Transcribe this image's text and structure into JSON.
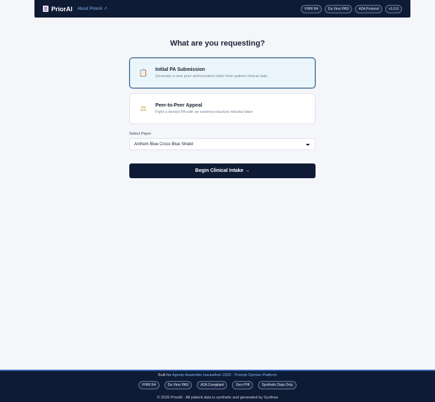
{
  "header": {
    "logo_icon": "clipboard-icon",
    "logo_text": "PriorAI",
    "about_link": "About PriorAI ↗",
    "badges": [
      "FHIR R4",
      "Da Vinci PAS",
      "A2A Protocol",
      "v1.0.0"
    ]
  },
  "main": {
    "title": "What are you requesting?",
    "options": [
      {
        "icon": "clipboard-icon",
        "glyph": "📋",
        "title": "Initial PA Submission",
        "description": "Generate a new prior authorization letter from patient clinical data"
      },
      {
        "icon": "scales-icon",
        "glyph": "⚖",
        "title": "Peer-to-Peer Appeal",
        "description": "Fight a denied PA with an evidence-backed rebuttal letter"
      }
    ],
    "payer_label": "Select Payer",
    "payer_selected": "Anthem Blue Cross Blue Shield",
    "begin_button": "Begin Clinical Intake →"
  },
  "footer": {
    "built_for_prefix": "Built for",
    "built_for_link": "Agents Assemble Hackathon 2026 · Prompt Opinion Platform",
    "badges": [
      "FHIR R4",
      "Da Vinci PAS",
      "A2A Compliant",
      "Zero PHI",
      "Synthetic Data Only"
    ],
    "copyright": "© 2026 PriorAI · All patient data is synthetic and generated by Synthea"
  },
  "colors": {
    "navy": "#0f1b35",
    "accent_link": "#7fb4f0",
    "selected_bg": "#eaf6fc"
  }
}
